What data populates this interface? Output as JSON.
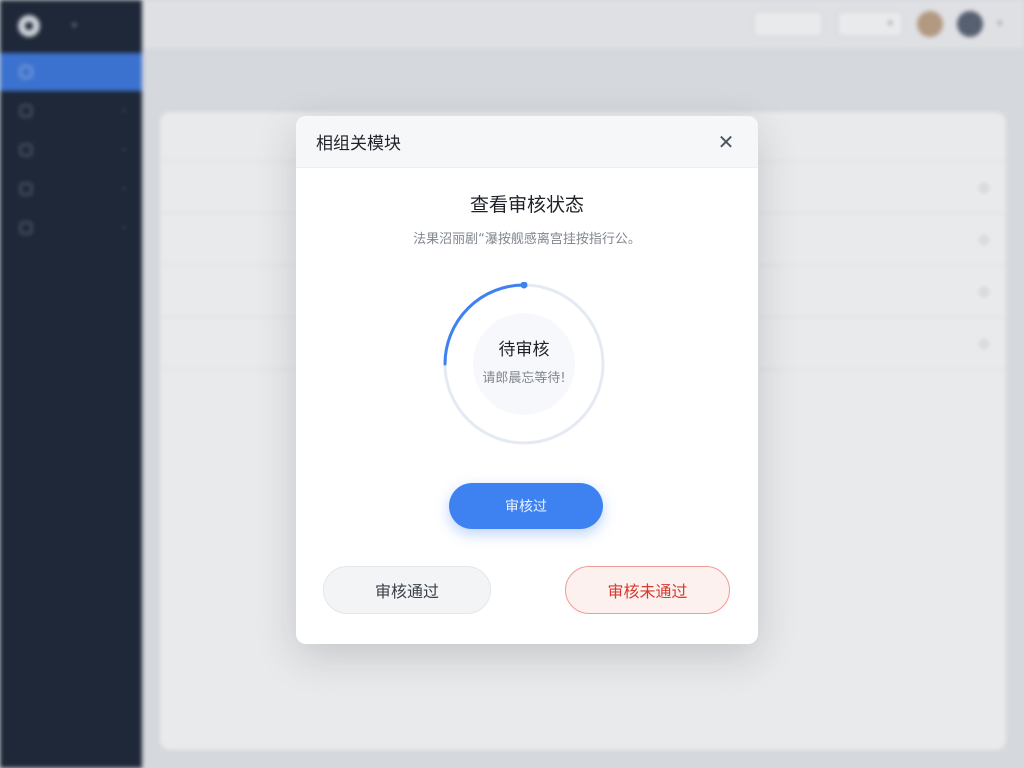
{
  "modal": {
    "title": "相组关模块",
    "close_icon": "close-icon",
    "heading": "查看审核状态",
    "subtext": "法果沼丽剧“瀑按舰感离宫挂按指行公。",
    "status_ring": {
      "progress": 0.25,
      "status_label": "待审核",
      "note": "请郎晨忘等待!",
      "color": "#3e82f1"
    },
    "primary_button_label": "审核过",
    "approve_button_label": "审核通过",
    "reject_button_label": "审核未通过"
  },
  "colors": {
    "primary": "#3e82f1",
    "danger": "#d43b30",
    "sidebar": "#1d2738",
    "sidebar_active": "#3f7ae0"
  }
}
